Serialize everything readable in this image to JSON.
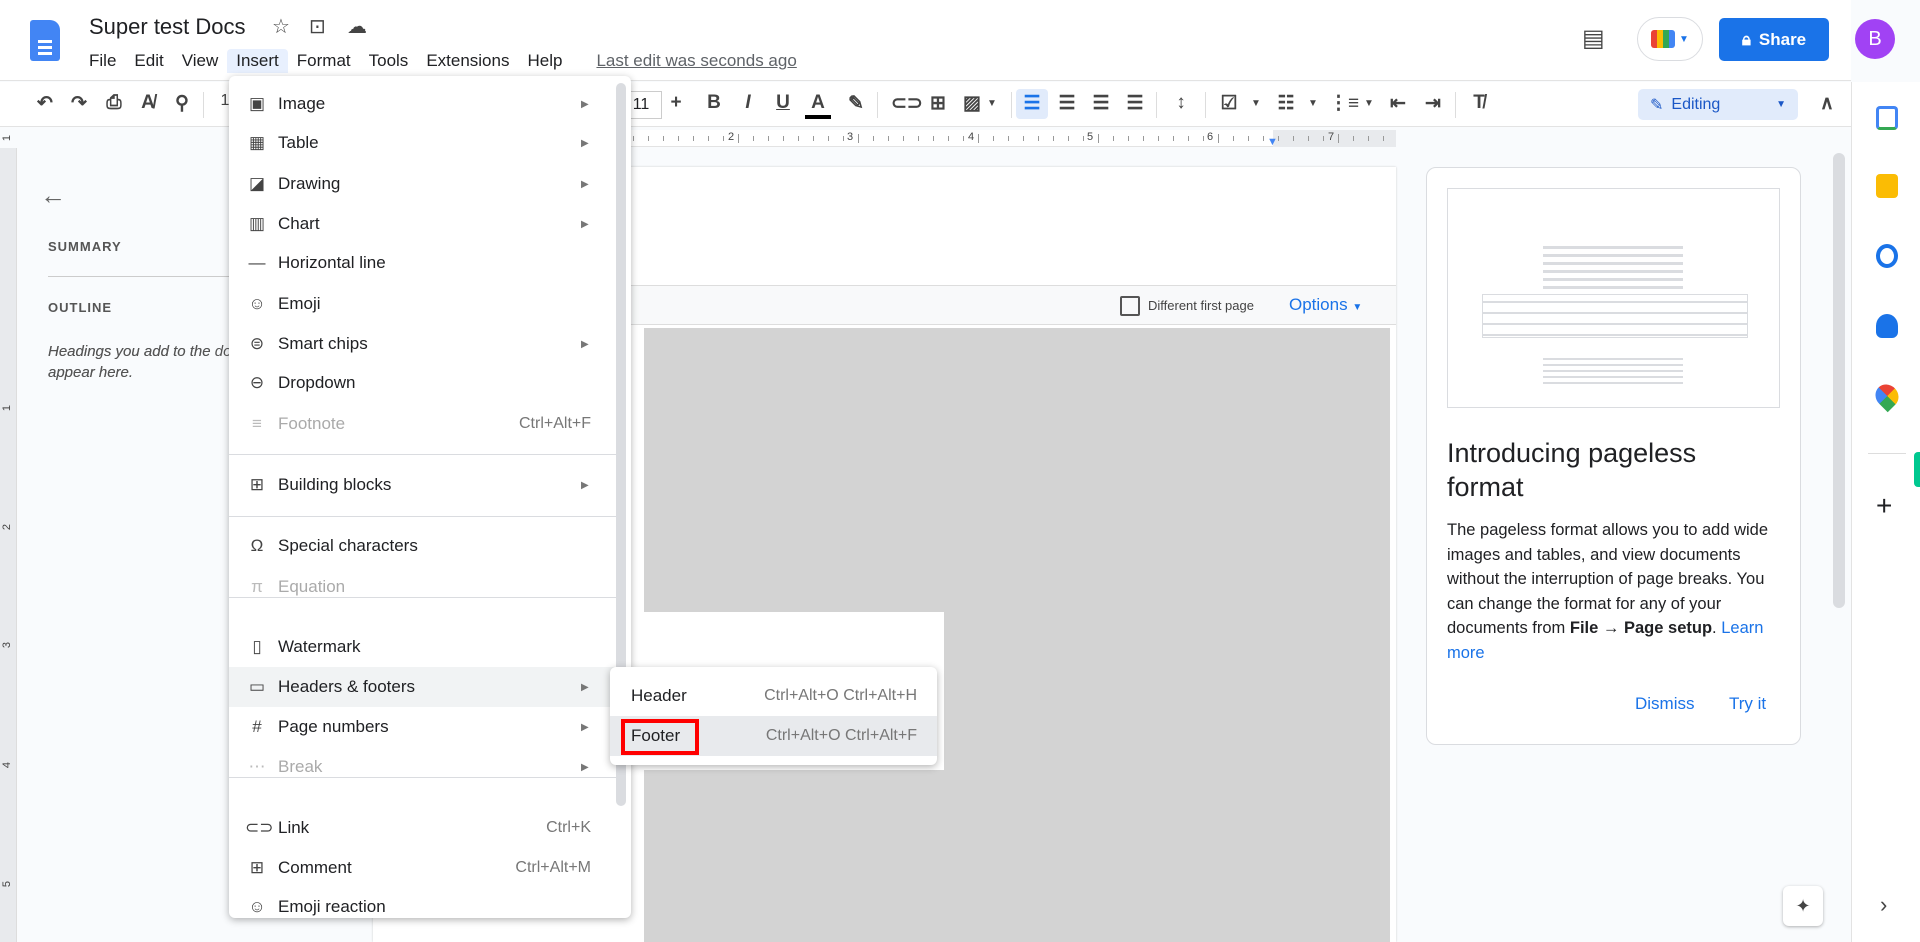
{
  "header": {
    "title": "Super test Docs",
    "menus": [
      "File",
      "Edit",
      "View",
      "Insert",
      "Format",
      "Tools",
      "Extensions",
      "Help"
    ],
    "active_menu": "Insert",
    "last_edit": "Last edit was seconds ago",
    "share_label": "Share",
    "avatar_letter": "B"
  },
  "toolbar": {
    "font_size": "11",
    "editing_label": "Editing",
    "zoom_partial": "1"
  },
  "ruler": {
    "numbers": [
      "2",
      "3",
      "4",
      "5",
      "6",
      "7"
    ],
    "vertical_numbers": [
      "1",
      "1",
      "2",
      "3",
      "4",
      "5"
    ]
  },
  "outline": {
    "summary": "SUMMARY",
    "outline": "OUTLINE",
    "hint": "Headings you add to the document will appear here.",
    "hint_line1": "Headings you add to the",
    "hint_line2": "appear here."
  },
  "header_bar": {
    "different_first_page": "Different first page",
    "options": "Options"
  },
  "promo": {
    "title": "Introducing pageless format",
    "body": "The pageless format allows you to add wide images and tables, and view documents without the interruption of page breaks. You can change the format for any of your documents from ",
    "bold1": "File →",
    "bold2": "Page setup",
    "period": ".",
    "learn_more": "Learn more",
    "dismiss": "Dismiss",
    "try_it": "Try it"
  },
  "insert_menu": [
    {
      "label": "Image",
      "icon": "image-icon",
      "submenu": true
    },
    {
      "label": "Table",
      "icon": "table-icon",
      "submenu": true
    },
    {
      "label": "Drawing",
      "icon": "drawing-icon",
      "submenu": true
    },
    {
      "label": "Chart",
      "icon": "chart-icon",
      "submenu": true
    },
    {
      "label": "Horizontal line",
      "icon": "horizontal-line-icon"
    },
    {
      "label": "Emoji",
      "icon": "emoji-icon"
    },
    {
      "label": "Smart chips",
      "icon": "smart-chips-icon",
      "submenu": true
    },
    {
      "label": "Dropdown",
      "icon": "dropdown-icon"
    },
    {
      "label": "Footnote",
      "icon": "footnote-icon",
      "shortcut": "Ctrl+Alt+F",
      "disabled": true
    },
    {
      "label": "Building blocks",
      "icon": "building-blocks-icon",
      "submenu": true
    },
    {
      "label": "Special characters",
      "icon": "omega-icon"
    },
    {
      "label": "Equation",
      "icon": "pi-icon",
      "disabled": true
    },
    {
      "label": "Watermark",
      "icon": "watermark-icon"
    },
    {
      "label": "Headers & footers",
      "icon": "headers-footers-icon",
      "submenu": true,
      "highlighted": true
    },
    {
      "label": "Page numbers",
      "icon": "hash-icon",
      "submenu": true
    },
    {
      "label": "Break",
      "icon": "break-icon",
      "submenu": true,
      "disabled": true
    },
    {
      "label": "Link",
      "icon": "link-icon",
      "shortcut": "Ctrl+K"
    },
    {
      "label": "Comment",
      "icon": "comment-icon",
      "shortcut": "Ctrl+Alt+M"
    },
    {
      "label": "Emoji reaction",
      "icon": "emoji-reaction-icon"
    }
  ],
  "submenu": [
    {
      "label": "Header",
      "shortcut": "Ctrl+Alt+O Ctrl+Alt+H"
    },
    {
      "label": "Footer",
      "shortcut": "Ctrl+Alt+O Ctrl+Alt+F",
      "highlighted": true
    }
  ],
  "colors": {
    "accent": "#1a73e8",
    "highlight_box": "#ff0000",
    "avatar": "#a142f4"
  }
}
